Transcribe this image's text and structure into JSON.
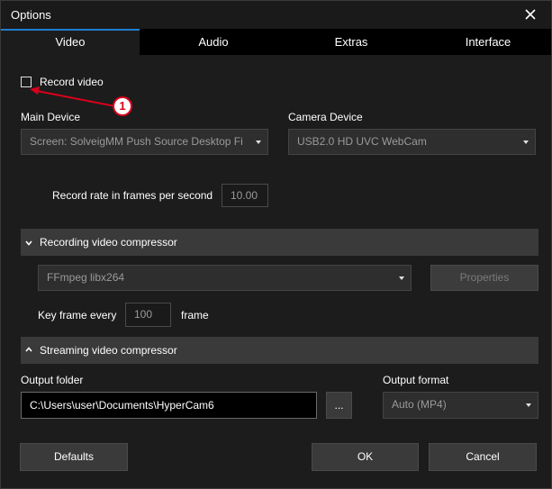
{
  "window": {
    "title": "Options"
  },
  "tabs": [
    {
      "label": "Video",
      "active": true
    },
    {
      "label": "Audio",
      "active": false
    },
    {
      "label": "Extras",
      "active": false
    },
    {
      "label": "Interface",
      "active": false
    }
  ],
  "record_video": {
    "label": "Record video",
    "checked": false
  },
  "main_device": {
    "label": "Main Device",
    "value": "Screen: SolveigMM Push Source Desktop Fi"
  },
  "camera_device": {
    "label": "Camera Device",
    "value": "USB2.0 HD UVC WebCam"
  },
  "record_rate": {
    "label": "Record rate in frames per second",
    "value": "10.00"
  },
  "recording_compressor": {
    "title": "Recording video compressor",
    "codec": "FFmpeg libx264",
    "properties_label": "Properties"
  },
  "key_frame": {
    "label_before": "Key frame every",
    "value": "100",
    "label_after": "frame"
  },
  "streaming_compressor": {
    "title": "Streaming video compressor"
  },
  "output_folder": {
    "label": "Output folder",
    "value": "C:\\Users\\user\\Documents\\HyperCam6",
    "browse_label": "..."
  },
  "output_format": {
    "label": "Output format",
    "value": "Auto (MP4)"
  },
  "buttons": {
    "defaults": "Defaults",
    "ok": "OK",
    "cancel": "Cancel"
  },
  "annotation": {
    "number": "1"
  },
  "colors": {
    "accent": "#1f7fd0",
    "annotation_red": "#d9001b",
    "background": "#1c1c1c",
    "section_bar": "#3a3a3a"
  }
}
